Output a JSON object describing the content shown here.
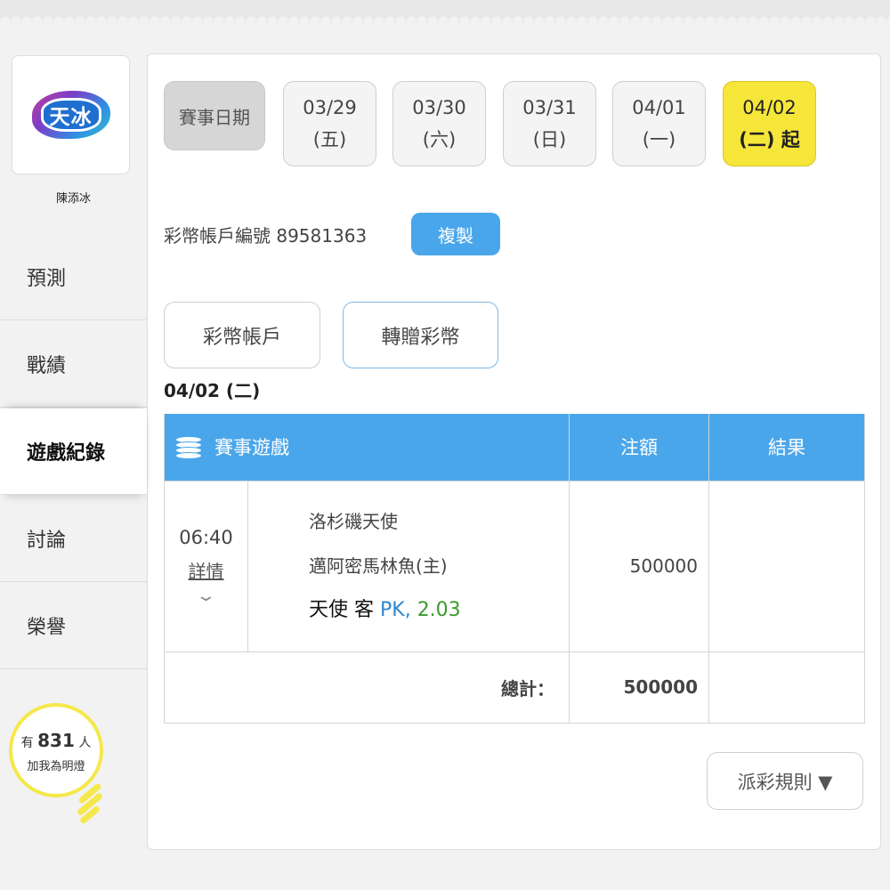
{
  "sidebar": {
    "logo_text": "天冰",
    "user_name": "陳添冰",
    "items": [
      {
        "label": "預測"
      },
      {
        "label": "戰績"
      },
      {
        "label": "遊戲紀錄"
      },
      {
        "label": "討論"
      },
      {
        "label": "榮譽"
      }
    ],
    "active_index": 2,
    "lamp": {
      "prefix": "有",
      "count": "831",
      "suffix": "人",
      "line2": "加我為明燈"
    }
  },
  "dates": {
    "label": "賽事日期",
    "items": [
      {
        "date": "03/29",
        "day": "(五)"
      },
      {
        "date": "03/30",
        "day": "(六)"
      },
      {
        "date": "03/31",
        "day": "(日)"
      },
      {
        "date": "04/01",
        "day": "(一)"
      },
      {
        "date": "04/02",
        "day": "(二) 起"
      }
    ],
    "active_index": 4
  },
  "account": {
    "label": "彩幣帳戶編號 89581363",
    "copy_label": "複製"
  },
  "tabs": {
    "account_label": "彩幣帳戶",
    "transfer_label": "轉贈彩幣"
  },
  "section_date": "04/02 (二)",
  "table": {
    "headers": {
      "game": "賽事遊戲",
      "amount": "注額",
      "result": "結果"
    },
    "rows": [
      {
        "time": "06:40",
        "detail_label": "詳情",
        "away_team": "洛杉磯天使",
        "home_team": "邁阿密馬林魚(主)",
        "pick_team": "天使 客",
        "pick_type": "PK,",
        "odds": "2.03",
        "amount": "500000",
        "result": ""
      }
    ],
    "total_label": "總計：",
    "total_amount": "500000"
  },
  "rules_label": "派彩規則 ▼",
  "colors": {
    "accent": "#4aa6ea",
    "active_date": "#f7e63a",
    "lamp": "#f5e84a",
    "pk": "#2f86cf",
    "odds": "#3a9b2c"
  }
}
